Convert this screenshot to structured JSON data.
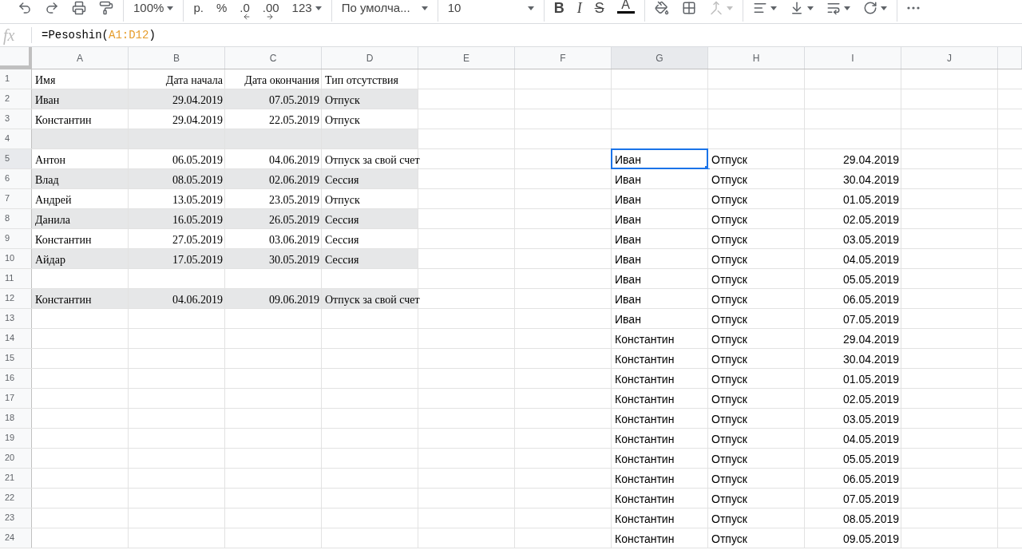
{
  "toolbar": {
    "groups": [
      [
        {
          "kind": "undo"
        },
        {
          "kind": "redo"
        },
        {
          "kind": "print"
        },
        {
          "kind": "paint_format"
        }
      ],
      [
        {
          "kind": "dropdown",
          "label": "100%"
        }
      ],
      [
        {
          "kind": "text",
          "label": "р."
        },
        {
          "kind": "text",
          "label": "%"
        },
        {
          "kind": "decimal_less",
          "label": ".0"
        },
        {
          "kind": "decimal_more",
          "label": ".00"
        },
        {
          "kind": "dropdown",
          "label": "123"
        }
      ],
      [
        {
          "kind": "dropdown_wide",
          "label": "По умолча..."
        }
      ],
      [
        {
          "kind": "dropdown_wide",
          "label": "10"
        }
      ],
      [
        {
          "kind": "bold",
          "label": "B"
        },
        {
          "kind": "italic",
          "label": "I"
        },
        {
          "kind": "strike",
          "label": "S"
        },
        {
          "kind": "text_color",
          "label": "A",
          "color": "#000000"
        }
      ],
      [
        {
          "kind": "fill"
        },
        {
          "kind": "borders"
        },
        {
          "kind": "merge",
          "disabled": true
        }
      ],
      [
        {
          "kind": "align"
        },
        {
          "kind": "valign"
        },
        {
          "kind": "wrap"
        },
        {
          "kind": "rotate"
        }
      ],
      [
        {
          "kind": "more"
        }
      ]
    ]
  },
  "formula_bar": {
    "icon_label": "fx",
    "parts": [
      {
        "kind": "plain",
        "text": "=Pesoshin("
      },
      {
        "kind": "ref",
        "text": "A1:D12"
      },
      {
        "kind": "plain",
        "text": ")"
      }
    ]
  },
  "columns": [
    {
      "label": "A",
      "selected": false
    },
    {
      "label": "B",
      "selected": false
    },
    {
      "label": "C",
      "selected": false
    },
    {
      "label": "D",
      "selected": false
    },
    {
      "label": "E",
      "selected": false
    },
    {
      "label": "F",
      "selected": false
    },
    {
      "label": "G",
      "selected": true
    },
    {
      "label": "H",
      "selected": false
    },
    {
      "label": "I",
      "selected": false
    },
    {
      "label": "J",
      "selected": false
    }
  ],
  "rows": [
    {
      "number": "1",
      "banded": false,
      "selected": false,
      "cells": {
        "A": "Имя",
        "B": "Дата начала",
        "C": "Дата окончания",
        "D": "Тип отсутствия"
      }
    },
    {
      "number": "2",
      "banded": true,
      "selected": false,
      "cells": {
        "A": "Иван",
        "B": "29.04.2019",
        "C": "07.05.2019",
        "D": "Отпуск"
      }
    },
    {
      "number": "3",
      "banded": false,
      "selected": false,
      "cells": {
        "A": "Константин",
        "B": "29.04.2019",
        "C": "22.05.2019",
        "D": "Отпуск"
      }
    },
    {
      "number": "4",
      "banded": true,
      "selected": false,
      "cells": {}
    },
    {
      "number": "5",
      "banded": false,
      "selected": true,
      "cells": {
        "A": "Антон",
        "B": "06.05.2019",
        "C": "04.06.2019",
        "D": "Отпуск за свой счет",
        "G": "Иван",
        "H": "Отпуск",
        "I": "29.04.2019"
      }
    },
    {
      "number": "6",
      "banded": true,
      "selected": false,
      "cells": {
        "A": "Влад",
        "B": "08.05.2019",
        "C": "02.06.2019",
        "D": "Сессия",
        "G": "Иван",
        "H": "Отпуск",
        "I": "30.04.2019"
      }
    },
    {
      "number": "7",
      "banded": false,
      "selected": false,
      "cells": {
        "A": "Андрей",
        "B": "13.05.2019",
        "C": "23.05.2019",
        "D": "Отпуск",
        "G": "Иван",
        "H": "Отпуск",
        "I": "01.05.2019"
      }
    },
    {
      "number": "8",
      "banded": true,
      "selected": false,
      "cells": {
        "A": "Данила",
        "B": "16.05.2019",
        "C": "26.05.2019",
        "D": "Сессия",
        "G": "Иван",
        "H": "Отпуск",
        "I": "02.05.2019"
      }
    },
    {
      "number": "9",
      "banded": false,
      "selected": false,
      "cells": {
        "A": "Константин",
        "B": "27.05.2019",
        "C": "03.06.2019",
        "D": "Сессия",
        "G": "Иван",
        "H": "Отпуск",
        "I": "03.05.2019"
      }
    },
    {
      "number": "10",
      "banded": true,
      "selected": false,
      "cells": {
        "A": "Айдар",
        "B": "17.05.2019",
        "C": "30.05.2019",
        "D": "Сессия",
        "G": "Иван",
        "H": "Отпуск",
        "I": "04.05.2019"
      }
    },
    {
      "number": "11",
      "banded": false,
      "selected": false,
      "cells": {
        "G": "Иван",
        "H": "Отпуск",
        "I": "05.05.2019"
      }
    },
    {
      "number": "12",
      "banded": true,
      "selected": false,
      "cells": {
        "A": "Константин",
        "B": "04.06.2019",
        "C": "09.06.2019",
        "D": "Отпуск за свой счет",
        "G": "Иван",
        "H": "Отпуск",
        "I": "06.05.2019"
      }
    },
    {
      "number": "13",
      "banded": false,
      "selected": false,
      "cells": {
        "G": "Иван",
        "H": "Отпуск",
        "I": "07.05.2019"
      }
    },
    {
      "number": "14",
      "banded": false,
      "selected": false,
      "cells": {
        "G": "Константин",
        "H": "Отпуск",
        "I": "29.04.2019"
      }
    },
    {
      "number": "15",
      "banded": false,
      "selected": false,
      "cells": {
        "G": "Константин",
        "H": "Отпуск",
        "I": "30.04.2019"
      }
    },
    {
      "number": "16",
      "banded": false,
      "selected": false,
      "cells": {
        "G": "Константин",
        "H": "Отпуск",
        "I": "01.05.2019"
      }
    },
    {
      "number": "17",
      "banded": false,
      "selected": false,
      "cells": {
        "G": "Константин",
        "H": "Отпуск",
        "I": "02.05.2019"
      }
    },
    {
      "number": "18",
      "banded": false,
      "selected": false,
      "cells": {
        "G": "Константин",
        "H": "Отпуск",
        "I": "03.05.2019"
      }
    },
    {
      "number": "19",
      "banded": false,
      "selected": false,
      "cells": {
        "G": "Константин",
        "H": "Отпуск",
        "I": "04.05.2019"
      }
    },
    {
      "number": "20",
      "banded": false,
      "selected": false,
      "cells": {
        "G": "Константин",
        "H": "Отпуск",
        "I": "05.05.2019"
      }
    },
    {
      "number": "21",
      "banded": false,
      "selected": false,
      "cells": {
        "G": "Константин",
        "H": "Отпуск",
        "I": "06.05.2019"
      }
    },
    {
      "number": "22",
      "banded": false,
      "selected": false,
      "cells": {
        "G": "Константин",
        "H": "Отпуск",
        "I": "07.05.2019"
      }
    },
    {
      "number": "23",
      "banded": false,
      "selected": false,
      "cells": {
        "G": "Константин",
        "H": "Отпуск",
        "I": "08.05.2019"
      }
    },
    {
      "number": "24",
      "banded": false,
      "selected": false,
      "cells": {
        "G": "Константин",
        "H": "Отпуск",
        "I": "09.05.2019"
      }
    }
  ]
}
